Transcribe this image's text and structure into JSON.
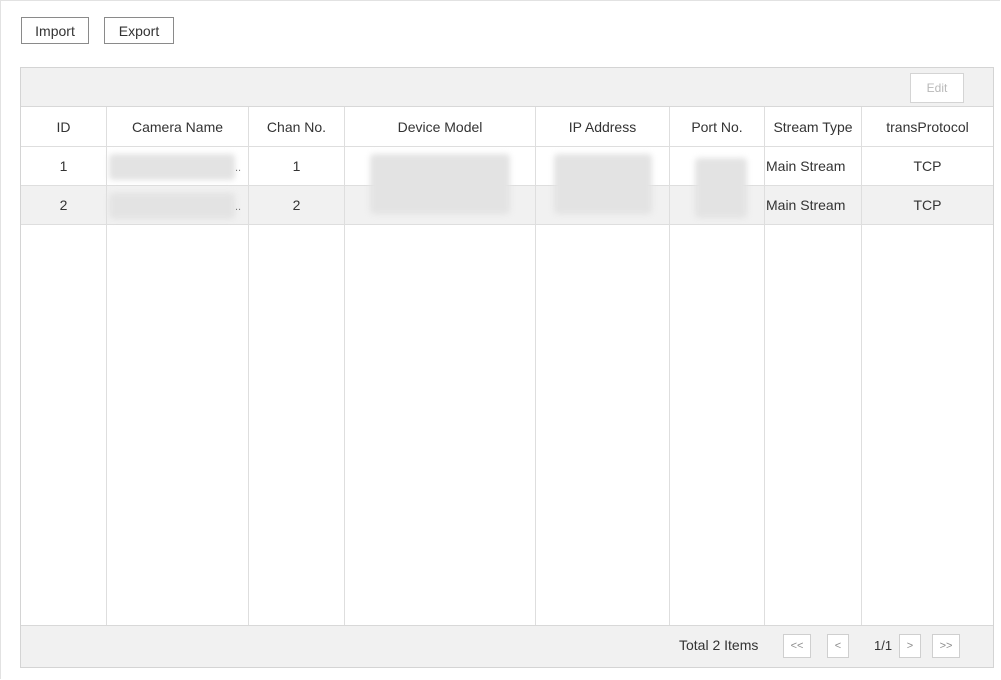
{
  "toolbar": {
    "import_label": "Import",
    "export_label": "Export",
    "edit_label": "Edit"
  },
  "table": {
    "columns": [
      "ID",
      "Camera Name",
      "Chan No.",
      "Device Model",
      "IP Address",
      "Port No.",
      "Stream Type",
      "transProtocol"
    ],
    "rows": [
      {
        "id": "1",
        "camera_name": "..",
        "chan_no": "1",
        "device_model": "",
        "ip_address": "",
        "port_no": "",
        "stream_type": "Main Stream",
        "trans_protocol": "TCP"
      },
      {
        "id": "2",
        "camera_name": "..",
        "chan_no": "2",
        "device_model": "",
        "ip_address": "",
        "port_no": "",
        "stream_type": "Main Stream",
        "trans_protocol": "TCP"
      }
    ]
  },
  "pagination": {
    "total_label": "Total 2 Items",
    "first": "<<",
    "prev": "<",
    "page": "1/1",
    "next": ">",
    "last": ">>"
  }
}
